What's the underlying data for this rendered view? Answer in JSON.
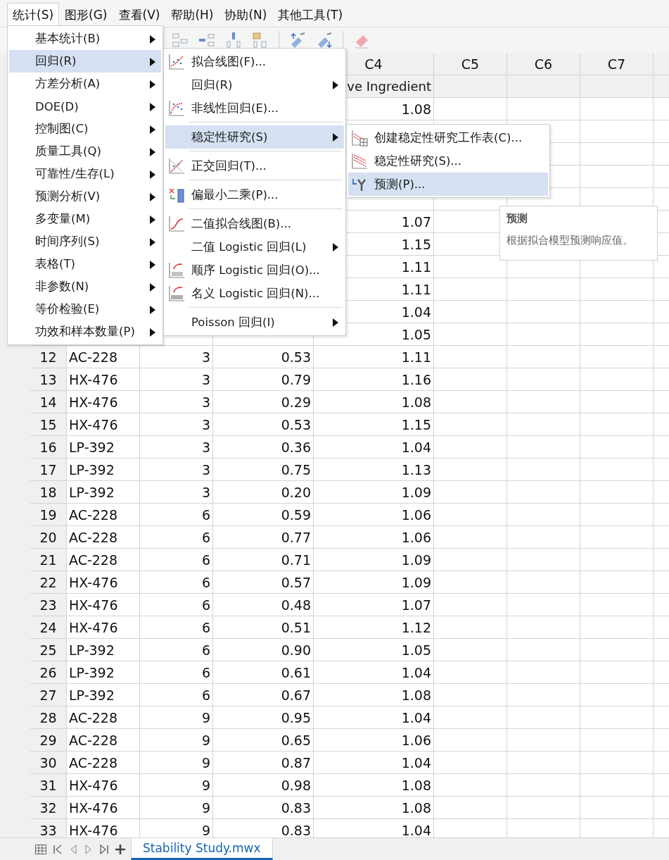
{
  "menu_bar": [
    {
      "label": "统计(S)",
      "selected": true
    },
    {
      "label": "图形(G)",
      "selected": false
    },
    {
      "label": "查看(V)",
      "selected": false
    },
    {
      "label": "帮助(H)",
      "selected": false
    },
    {
      "label": "协助(N)",
      "selected": false
    },
    {
      "label": "其他工具(T)",
      "selected": false
    }
  ],
  "stat_menu": [
    {
      "label": "基本统计(B)",
      "selected": false
    },
    {
      "label": "回归(R)",
      "selected": true
    },
    {
      "label": "方差分析(A)",
      "selected": false
    },
    {
      "label": "DOE(D)",
      "selected": false
    },
    {
      "label": "控制图(C)",
      "selected": false
    },
    {
      "label": "质量工具(Q)",
      "selected": false
    },
    {
      "label": "可靠性/生存(L)",
      "selected": false
    },
    {
      "label": "预测分析(V)",
      "selected": false
    },
    {
      "label": "多变量(M)",
      "selected": false
    },
    {
      "label": "时间序列(S)",
      "selected": false
    },
    {
      "label": "表格(T)",
      "selected": false
    },
    {
      "label": "非参数(N)",
      "selected": false
    },
    {
      "label": "等价检验(E)",
      "selected": false
    },
    {
      "label": "功效和样本数量(P)",
      "selected": false
    }
  ],
  "regression_menu": [
    {
      "label": "拟合线图(F)...",
      "kind": "command",
      "selected": false,
      "separator_after": false
    },
    {
      "label": "回归(R)",
      "kind": "submenu",
      "selected": false,
      "separator_after": false
    },
    {
      "label": "非线性回归(E)...",
      "kind": "command",
      "selected": false,
      "separator_after": true
    },
    {
      "label": "稳定性研究(S)",
      "kind": "submenu",
      "selected": true,
      "separator_after": true
    },
    {
      "label": "正交回归(T)...",
      "kind": "command",
      "selected": false,
      "separator_after": true
    },
    {
      "label": "偏最小二乘(P)...",
      "kind": "command",
      "selected": false,
      "separator_after": true
    },
    {
      "label": "二值拟合线图(B)...",
      "kind": "command",
      "selected": false,
      "separator_after": false
    },
    {
      "label": "二值 Logistic 回归(L)",
      "kind": "submenu",
      "selected": false,
      "separator_after": false
    },
    {
      "label": "顺序 Logistic 回归(O)...",
      "kind": "command",
      "selected": false,
      "separator_after": false
    },
    {
      "label": "名义 Logistic 回归(N)...",
      "kind": "command",
      "selected": false,
      "separator_after": true
    },
    {
      "label": "Poisson 回归(I)",
      "kind": "submenu",
      "selected": false,
      "separator_after": false
    }
  ],
  "stability_menu": [
    {
      "label": "创建稳定性研究工作表(C)...",
      "selected": false
    },
    {
      "label": "稳定性研究(S)...",
      "selected": false
    },
    {
      "label": "预测(P)...",
      "selected": true
    }
  ],
  "tooltip": {
    "title": "预测",
    "text": "根据拟合模型预测响应值。"
  },
  "columns": [
    {
      "id": "C4",
      "name": "ve Ingredient"
    },
    {
      "id": "C5"
    },
    {
      "id": "C6"
    },
    {
      "id": "C7"
    }
  ],
  "rows": [
    {
      "c4": "1.08"
    },
    {},
    {},
    {},
    {},
    {
      "c4": "1.07"
    },
    {
      "c4": "1.15"
    },
    {
      "c4": "1.11"
    },
    {
      "c4": "1.11"
    },
    {
      "c4": "1.04"
    },
    {
      "c4": "1.05"
    },
    {
      "number": "12",
      "c1": "AC-228",
      "c2": "3",
      "c3": "0.53",
      "c4": "1.11"
    },
    {
      "number": "13",
      "c1": "HX-476",
      "c2": "3",
      "c3": "0.79",
      "c4": "1.16"
    },
    {
      "number": "14",
      "c1": "HX-476",
      "c2": "3",
      "c3": "0.29",
      "c4": "1.08"
    },
    {
      "number": "15",
      "c1": "HX-476",
      "c2": "3",
      "c3": "0.53",
      "c4": "1.15"
    },
    {
      "number": "16",
      "c1": "LP-392",
      "c2": "3",
      "c3": "0.36",
      "c4": "1.04"
    },
    {
      "number": "17",
      "c1": "LP-392",
      "c2": "3",
      "c3": "0.75",
      "c4": "1.13"
    },
    {
      "number": "18",
      "c1": "LP-392",
      "c2": "3",
      "c3": "0.20",
      "c4": "1.09"
    },
    {
      "number": "19",
      "c1": "AC-228",
      "c2": "6",
      "c3": "0.59",
      "c4": "1.06"
    },
    {
      "number": "20",
      "c1": "AC-228",
      "c2": "6",
      "c3": "0.77",
      "c4": "1.06"
    },
    {
      "number": "21",
      "c1": "AC-228",
      "c2": "6",
      "c3": "0.71",
      "c4": "1.09"
    },
    {
      "number": "22",
      "c1": "HX-476",
      "c2": "6",
      "c3": "0.57",
      "c4": "1.09"
    },
    {
      "number": "23",
      "c1": "HX-476",
      "c2": "6",
      "c3": "0.48",
      "c4": "1.07"
    },
    {
      "number": "24",
      "c1": "HX-476",
      "c2": "6",
      "c3": "0.51",
      "c4": "1.12"
    },
    {
      "number": "25",
      "c1": "LP-392",
      "c2": "6",
      "c3": "0.90",
      "c4": "1.05"
    },
    {
      "number": "26",
      "c1": "LP-392",
      "c2": "6",
      "c3": "0.61",
      "c4": "1.04"
    },
    {
      "number": "27",
      "c1": "LP-392",
      "c2": "6",
      "c3": "0.67",
      "c4": "1.08"
    },
    {
      "number": "28",
      "c1": "AC-228",
      "c2": "9",
      "c3": "0.95",
      "c4": "1.04"
    },
    {
      "number": "29",
      "c1": "AC-228",
      "c2": "9",
      "c3": "0.65",
      "c4": "1.06"
    },
    {
      "number": "30",
      "c1": "AC-228",
      "c2": "9",
      "c3": "0.87",
      "c4": "1.04"
    },
    {
      "number": "31",
      "c1": "HX-476",
      "c2": "9",
      "c3": "0.98",
      "c4": "1.08"
    },
    {
      "number": "32",
      "c1": "HX-476",
      "c2": "9",
      "c3": "0.83",
      "c4": "1.08"
    },
    {
      "number": "33",
      "c1": "HX-476",
      "c2": "9",
      "c3": "0.83",
      "c4": "1.04"
    }
  ],
  "sheet_tabs": [
    {
      "label": "Stability Study.mwx",
      "selected": true
    }
  ]
}
